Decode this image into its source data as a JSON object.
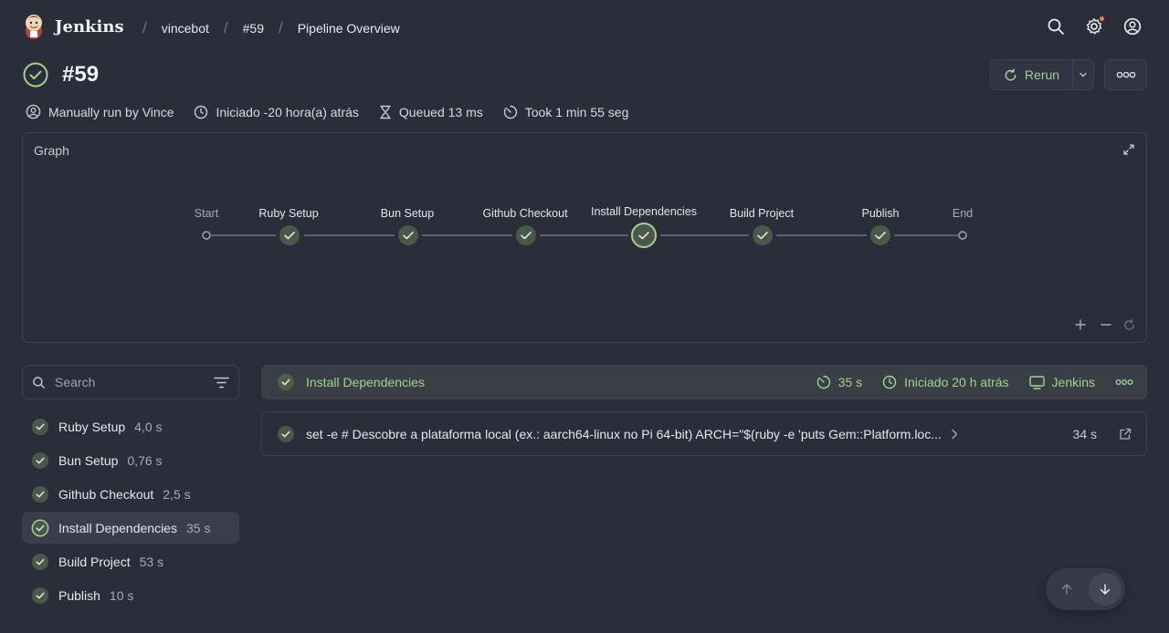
{
  "header": {
    "app_name": "Jenkins",
    "breadcrumbs": [
      "vincebot",
      "#59",
      "Pipeline Overview"
    ],
    "icons": [
      "search-icon",
      "settings-icon",
      "account-icon"
    ]
  },
  "run": {
    "title": "#59",
    "status": "success",
    "rerun_label": "Rerun",
    "meta": {
      "trigger": "Manually run by Vince",
      "started": "Iniciado -20 hora(a) atrás",
      "queued": "Queued 13 ms",
      "took": "Took 1 min 55 seg"
    }
  },
  "graph": {
    "title": "Graph",
    "start_label": "Start",
    "end_label": "End",
    "stages": [
      "Ruby Setup",
      "Bun Setup",
      "Github Checkout",
      "Install Dependencies",
      "Build Project",
      "Publish"
    ],
    "selected": "Install Dependencies"
  },
  "sidebar": {
    "search_placeholder": "Search",
    "stages": [
      {
        "name": "Ruby Setup",
        "duration": "4,0 s"
      },
      {
        "name": "Bun Setup",
        "duration": "0,76 s"
      },
      {
        "name": "Github Checkout",
        "duration": "2,5 s"
      },
      {
        "name": "Install Dependencies",
        "duration": "35 s"
      },
      {
        "name": "Build Project",
        "duration": "53 s"
      },
      {
        "name": "Publish",
        "duration": "10 s"
      }
    ]
  },
  "detail": {
    "stage_name": "Install Dependencies",
    "duration": "35 s",
    "started": "Iniciado 20 h atrás",
    "agent": "Jenkins",
    "step": {
      "command": "set -e # Descobre a plataforma local (ex.: aarch64-linux no Pi 64-bit) ARCH=\"$(ruby -e 'puts Gem::Platform.loc...",
      "duration": "34 s"
    }
  },
  "colors": {
    "background": "#2b2d3b",
    "success": "#9fd58a",
    "border": "#3e4150"
  }
}
